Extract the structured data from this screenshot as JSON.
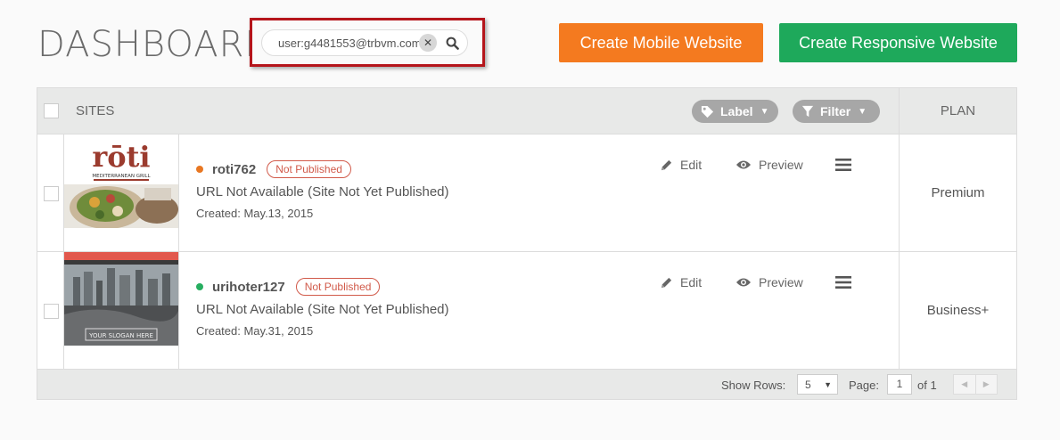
{
  "header": {
    "title": "DASHBOARD",
    "search": {
      "value": "user:g4481553@trbvm.com",
      "placeholder": ""
    },
    "create_mobile_label": "Create Mobile Website",
    "create_responsive_label": "Create Responsive Website"
  },
  "table": {
    "col_sites": "SITES",
    "col_plan": "PLAN",
    "label_pill": "Label",
    "filter_pill": "Filter",
    "rows": [
      {
        "name": "roti762",
        "status": "Not Published",
        "status_color": "#e87722",
        "url": "URL Not Available (Site Not Yet Published)",
        "created": "Created: May.13, 2015",
        "plan": "Premium",
        "edit_label": "Edit",
        "preview_label": "Preview",
        "thumb_brand": "rōti",
        "thumb_tagline": "MEDITERRANEAN GRILL"
      },
      {
        "name": "urihoter127",
        "status": "Not Published",
        "status_color": "#27ae60",
        "url": "URL Not Available (Site Not Yet Published)",
        "created": "Created: May.31, 2015",
        "plan": "Business+",
        "edit_label": "Edit",
        "preview_label": "Preview",
        "thumb_slogan": "YOUR SLOGAN HERE"
      }
    ]
  },
  "footer": {
    "show_rows_label": "Show Rows:",
    "rows_value": "5",
    "page_label": "Page:",
    "page_value": "1",
    "of_label": "of 1"
  },
  "colors": {
    "mobile_button": "#f47a1f",
    "responsive_button": "#1ea95b",
    "search_highlight": "#b5151b",
    "badge": "#d15a4a"
  }
}
